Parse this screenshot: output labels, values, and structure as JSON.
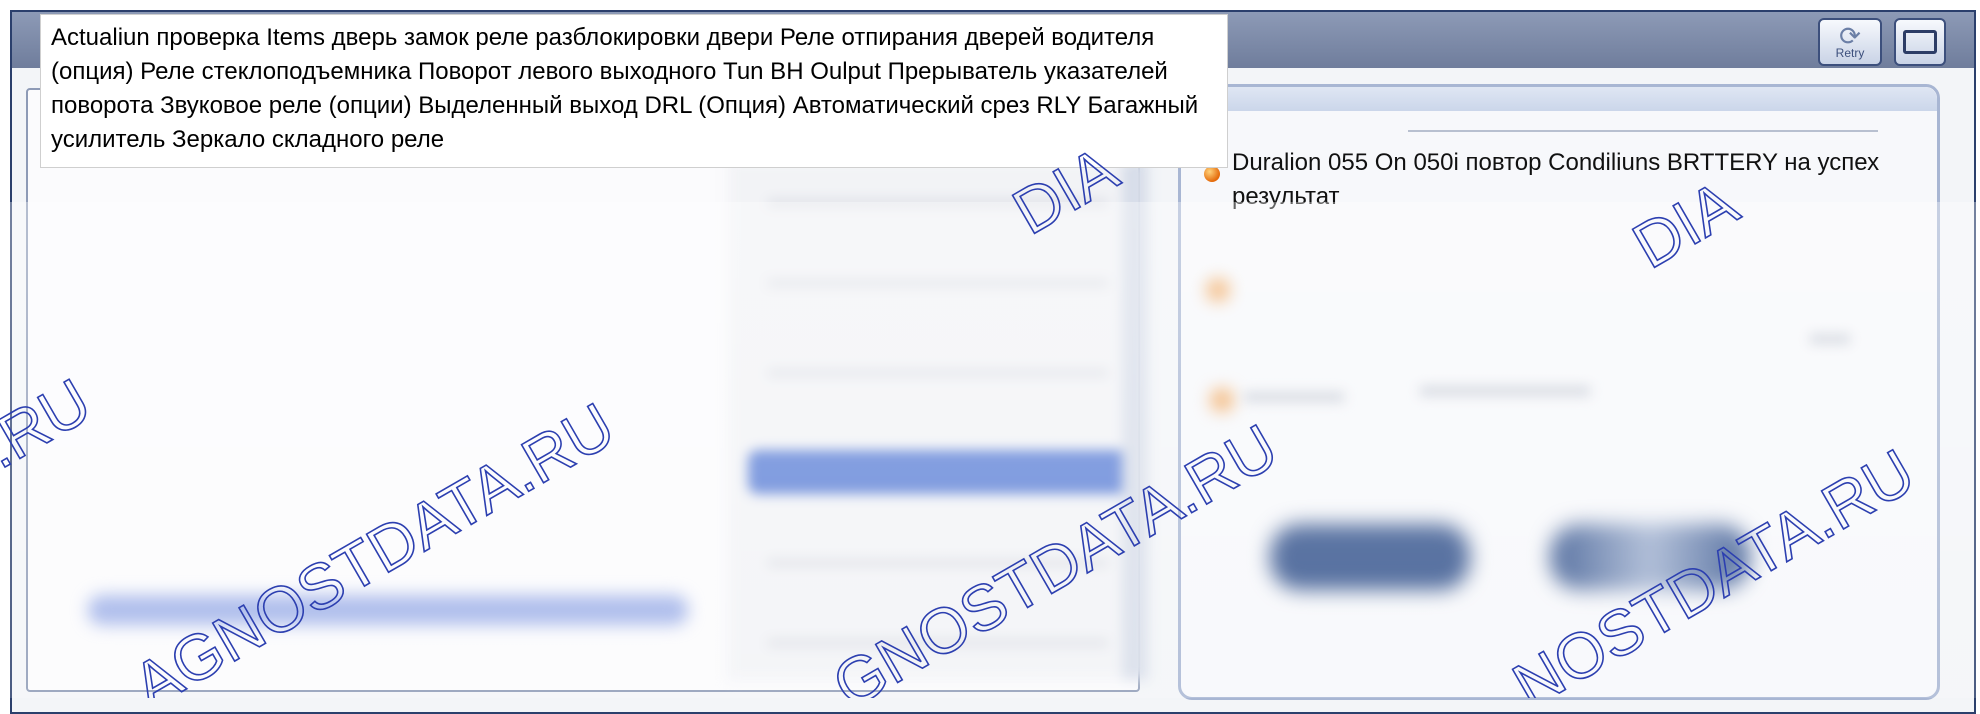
{
  "window": {
    "retry_button": {
      "label": "Retry",
      "icon": "retry-icon"
    },
    "maximize_button": {
      "icon": "maximize-icon"
    }
  },
  "tooltip": {
    "text": "Actualiun проверка Items дверь замок реле разблокировки двери Реле отпирания дверей водителя (опция) Реле стеклоподъемника Поворот левого выходного Tun BH Oulput Прерыватель указателей поворота Звуковое реле (опции) Выделенный выход DRL (Опция) Автоматический срез RLY Багажный усилитель Зеркало складного реле"
  },
  "status_panel": {
    "items": [
      {
        "icon": "orange-status-dot-icon",
        "text": "Duralion 055 On 050i повтор Condiliuns BRTTERY на успех результат"
      }
    ]
  },
  "watermark": {
    "text_full": "DIAGNOSTDATA.RU",
    "fragments": [
      ".RU",
      "AGNOSTDATA.RU",
      "GNOSTDATA.RU",
      "NOSTDATA.RU",
      "DIA",
      "DIA"
    ],
    "color": "#2c3fb0"
  },
  "colors": {
    "titlebar": "#7d8aa9",
    "frame": "#2b3f6c",
    "selection_blue": "#5b7fd6",
    "status_orange": "#e46a0a"
  }
}
